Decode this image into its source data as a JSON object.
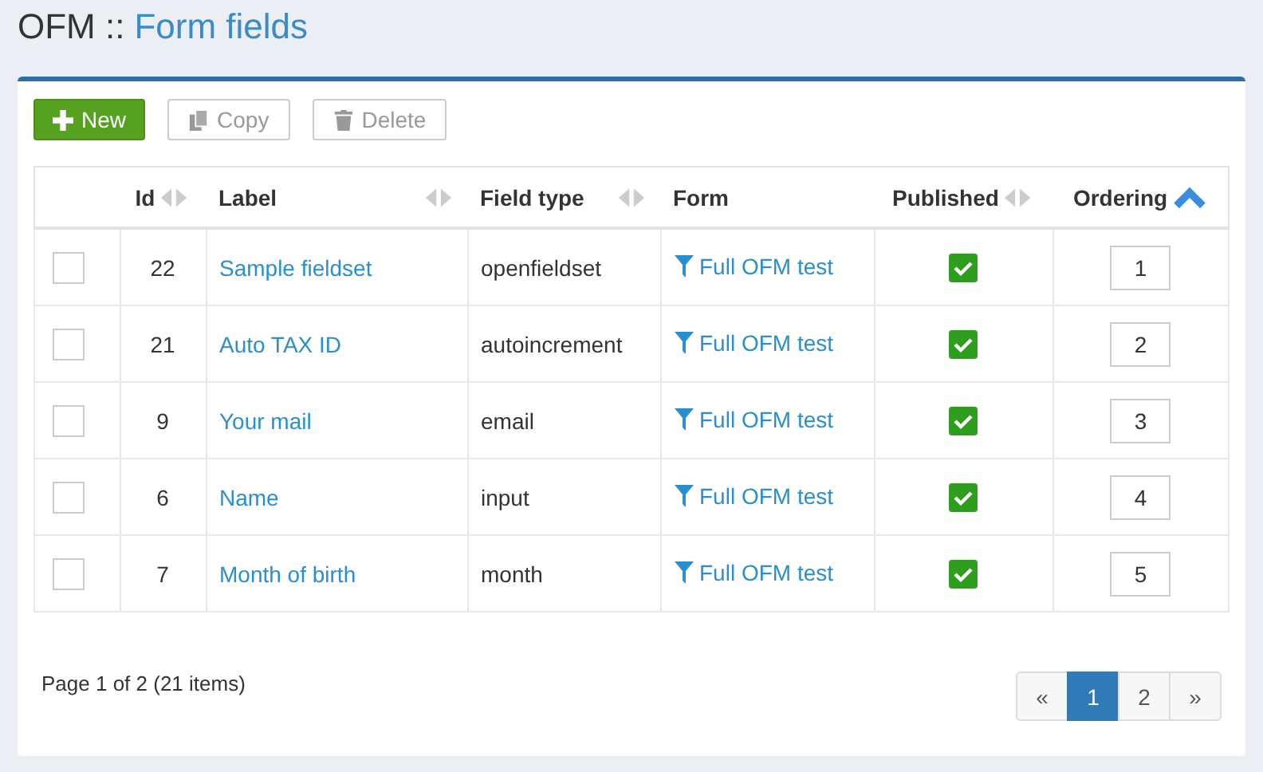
{
  "header": {
    "app": "OFM ::",
    "title": "Form fields"
  },
  "toolbar": [
    {
      "label": "New",
      "kind": "new",
      "disabled": false
    },
    {
      "label": "Copy",
      "kind": "copy",
      "disabled": true
    },
    {
      "label": "Delete",
      "kind": "delete",
      "disabled": true
    }
  ],
  "table": {
    "columns": [
      {
        "label": "Id",
        "sortable": true,
        "sorted": false
      },
      {
        "label": "Label",
        "sortable": true,
        "sorted": false
      },
      {
        "label": "Field type",
        "sortable": true,
        "sorted": false
      },
      {
        "label": "Form",
        "sortable": false
      },
      {
        "label": "Published",
        "sortable": true,
        "sorted": false
      },
      {
        "label": "Ordering",
        "sortable": true,
        "sorted": true
      }
    ],
    "rows": [
      {
        "checked": false,
        "id": "22",
        "label": "Sample fieldset",
        "type": "openfieldset",
        "form": "Full OFM test",
        "published": true,
        "ordering": "1"
      },
      {
        "checked": false,
        "id": "21",
        "label": "Auto TAX ID",
        "type": "autoincrement",
        "form": "Full OFM test",
        "published": true,
        "ordering": "2"
      },
      {
        "checked": false,
        "id": "9",
        "label": "Your mail",
        "type": "email",
        "form": "Full OFM test",
        "published": true,
        "ordering": "3"
      },
      {
        "checked": false,
        "id": "6",
        "label": "Name",
        "type": "input",
        "form": "Full OFM test",
        "published": true,
        "ordering": "4"
      },
      {
        "checked": false,
        "id": "7",
        "label": "Month of birth",
        "type": "month",
        "form": "Full OFM test",
        "published": true,
        "ordering": "5"
      }
    ]
  },
  "footer": {
    "summary": "Page 1 of 2 (21 items)",
    "pages": [
      {
        "label": "«",
        "selected": false
      },
      {
        "label": "1",
        "selected": true
      },
      {
        "label": "2",
        "selected": false
      },
      {
        "label": "»",
        "selected": false
      }
    ]
  }
}
